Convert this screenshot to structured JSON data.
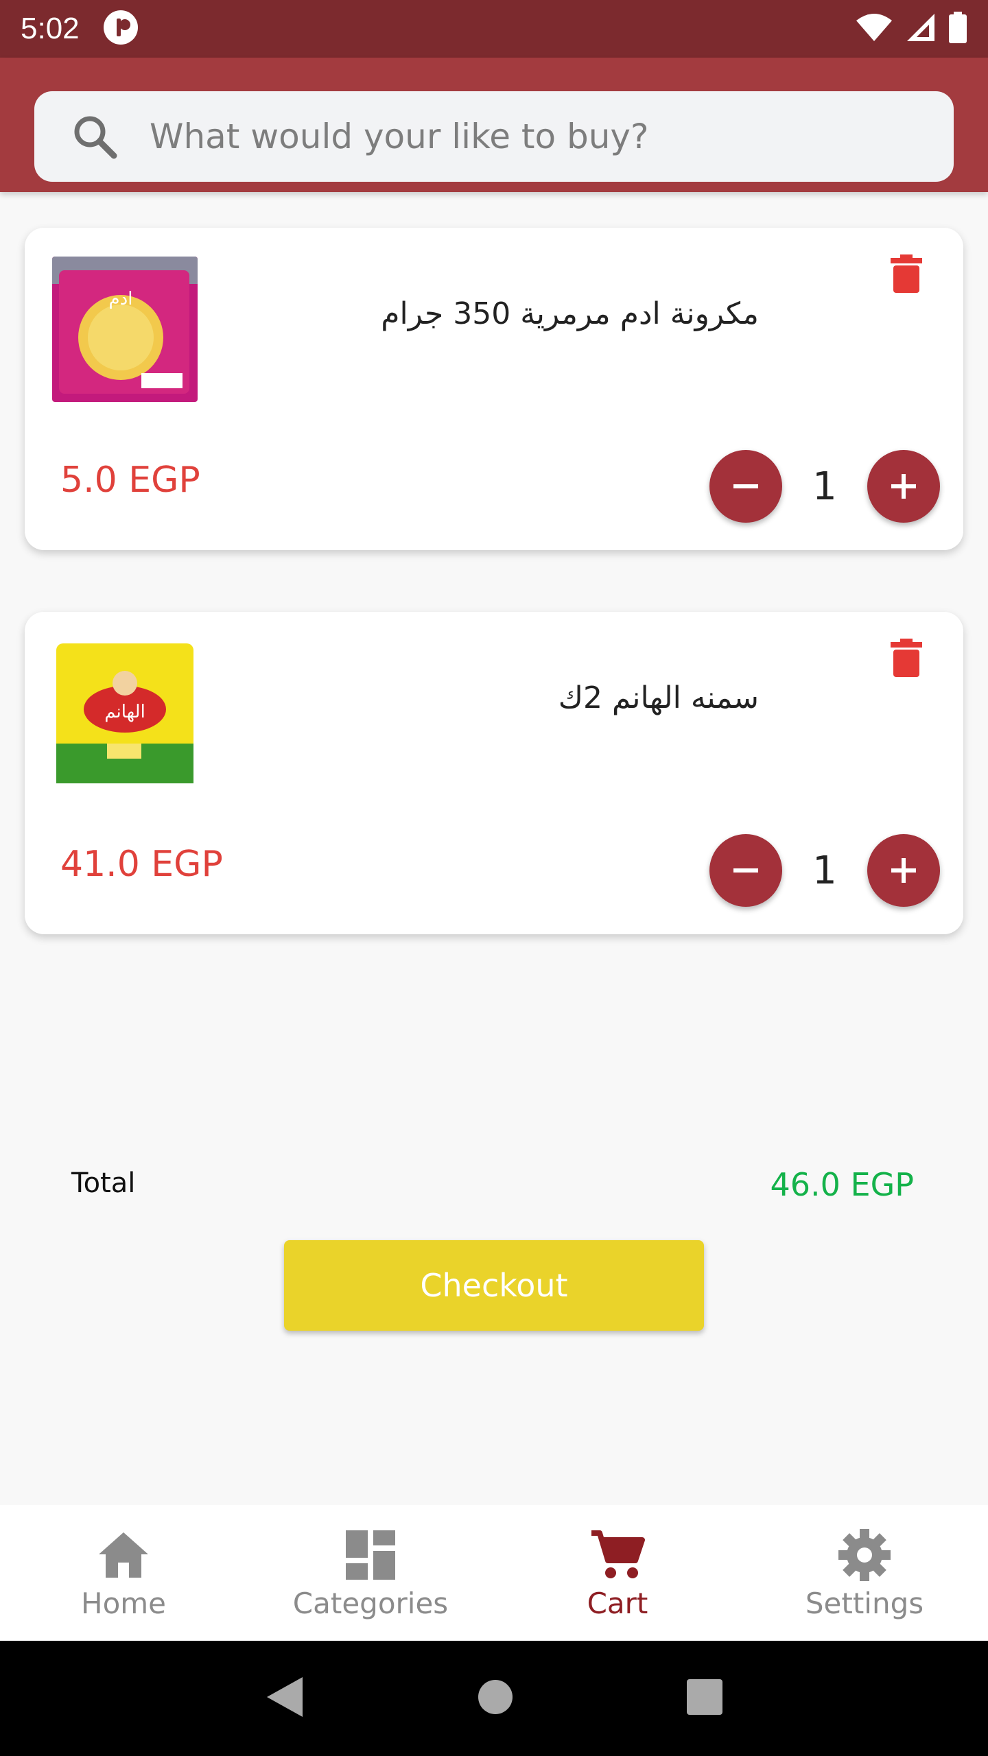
{
  "status_bar": {
    "time": "5:02"
  },
  "search": {
    "placeholder": "What would your like to buy?"
  },
  "cart_items": [
    {
      "name": "مكرونة ادم  مرمرية  350 جرام",
      "price": "5.0 EGP",
      "quantity": "1",
      "thumb_text": "ادم"
    },
    {
      "name": "سمنه الهانم 2ك",
      "price": "41.0 EGP",
      "quantity": "1",
      "thumb_text": "الهانم"
    }
  ],
  "summary": {
    "total_label": "Total",
    "total_value": "46.0 EGP",
    "checkout_label": "Checkout"
  },
  "bottom_nav": {
    "items": [
      {
        "label": "Home",
        "icon": "home-icon",
        "active": false
      },
      {
        "label": "Categories",
        "icon": "dashboard-icon",
        "active": false
      },
      {
        "label": "Cart",
        "icon": "cart-icon",
        "active": true
      },
      {
        "label": "Settings",
        "icon": "gear-icon",
        "active": false
      }
    ]
  },
  "colors": {
    "status_bar": "#7c2a2e",
    "app_bar": "#a33b3f",
    "accent": "#a3313a",
    "price": "#e0413b",
    "total": "#14b24a",
    "checkout": "#ead32a",
    "nav_active": "#8e1e23",
    "nav_inactive": "#8b8b8b"
  }
}
